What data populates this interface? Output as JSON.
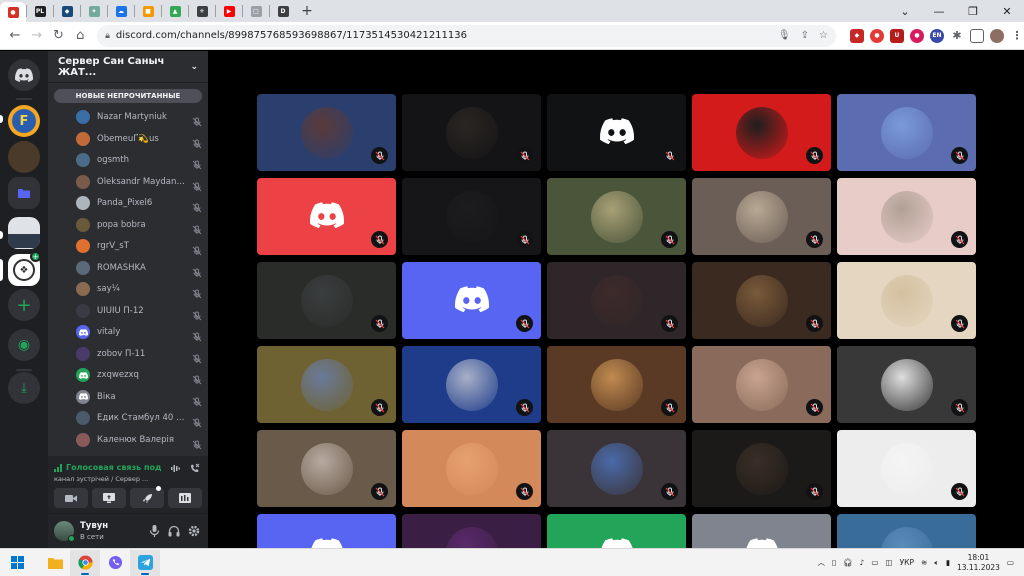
{
  "browser": {
    "tabs": [
      {
        "icon": "recording-icon",
        "color": "#d93025",
        "glyph": "●",
        "active": true
      },
      {
        "icon": "pl-icon",
        "color": "#202124",
        "glyph": "PL"
      },
      {
        "icon": "shield-icon",
        "color": "#1a4a7a",
        "glyph": "◆"
      },
      {
        "icon": "chatgpt-icon",
        "color": "#74aa9c",
        "glyph": "✦"
      },
      {
        "icon": "cloud-icon",
        "color": "#1a73e8",
        "glyph": "☁"
      },
      {
        "icon": "folder-icon",
        "color": "#f29900",
        "glyph": "■"
      },
      {
        "icon": "photo-icon",
        "color": "#34a853",
        "glyph": "▲"
      },
      {
        "icon": "emblem-icon",
        "color": "#3c4043",
        "glyph": "⚜"
      },
      {
        "icon": "youtube-icon",
        "color": "#ff0000",
        "glyph": "▶"
      },
      {
        "icon": "page-icon",
        "color": "#9aa0a6",
        "glyph": "□"
      },
      {
        "icon": "d-icon",
        "color": "#3c4043",
        "glyph": "D"
      }
    ],
    "new_tab": "+",
    "url": "discord.com/channels/899875768593698867/1173514530421211136",
    "window_controls": {
      "chevron": "⌄",
      "minimize": "—",
      "maximize": "❐",
      "close": "✕"
    }
  },
  "discord": {
    "server_name": "Сервер Сан Саныч ЖАТ...",
    "unread_label": "НОВЫЕ НЕПРОЧИТАННЫЕ",
    "members": [
      {
        "name": "Nazar Martyniuk",
        "avatar_color": "#3b6ea5"
      },
      {
        "name": "ObemeuҐ💫us",
        "avatar_color": "#c06a3a"
      },
      {
        "name": "ogsmth",
        "avatar_color": "#4a6b8a"
      },
      {
        "name": "Oleksandr Maydani...",
        "avatar_color": "#7a5a4a"
      },
      {
        "name": "Panda_Pixel6",
        "avatar_color": "#aeb4bb"
      },
      {
        "name": "popa bobra",
        "avatar_color": "#6b5a3a"
      },
      {
        "name": "rgrV_sT",
        "avatar_color": "#e07030"
      },
      {
        "name": "ROMASHKA",
        "avatar_color": "#5a6a7a"
      },
      {
        "name": "say¼",
        "avatar_color": "#8a6a50"
      },
      {
        "name": "UIUIU П-12",
        "avatar_color": "#3a3a44"
      },
      {
        "name": "vitaly",
        "avatar_color": "#5865f2",
        "discord_logo": true
      },
      {
        "name": "zobov П-11",
        "avatar_color": "#4a3a6a"
      },
      {
        "name": "zxqwezxq",
        "avatar_color": "#23a559",
        "discord_logo": true
      },
      {
        "name": "Віка",
        "avatar_color": "#80848e",
        "discord_logo": true
      },
      {
        "name": "Едик Стамбул 40 г...",
        "avatar_color": "#4a5a6a"
      },
      {
        "name": "Каленюк Валерія",
        "avatar_color": "#8a5a5a"
      }
    ],
    "voice": {
      "status": "Голосовая связь под",
      "channel": "канал зустрічей / Сервер ..."
    },
    "user": {
      "name": "Тувун",
      "status": "В сети"
    },
    "tiles": [
      {
        "bg": "#2a3f6e",
        "circle": "#5a3a3a"
      },
      {
        "bg": "#141416",
        "circle": "#2a2622"
      },
      {
        "bg": "#111214",
        "logo": true,
        "logo_color": "#ffffff"
      },
      {
        "bg": "#d41b1b",
        "circle": "#1e1e1e"
      },
      {
        "bg": "#5b6cb0",
        "circle": "#7a9ad8"
      },
      {
        "bg": "#ed4245",
        "logo": true,
        "logo_color": "#ffffff"
      },
      {
        "bg": "#161618",
        "circle": "#1c1c1e"
      },
      {
        "bg": "#4a553a",
        "circle": "#a8a076"
      },
      {
        "bg": "#6b5e56",
        "circle": "#b8a894"
      },
      {
        "bg": "#e8ccc8",
        "circle": "#b0a094"
      },
      {
        "bg": "#2a2c2a",
        "circle": "#3a3e3e"
      },
      {
        "bg": "#5865f2",
        "logo": true,
        "logo_color": "#ffffff"
      },
      {
        "bg": "#2e2628",
        "circle": "#3e2a2a"
      },
      {
        "bg": "#3a2a20",
        "circle": "#7a5a3a"
      },
      {
        "bg": "#e4d6c0",
        "circle": "#d4c0a0"
      },
      {
        "bg": "#6e6232",
        "circle": "#6a7a9a"
      },
      {
        "bg": "#1e3c8a",
        "circle": "#a8b0c8"
      },
      {
        "bg": "#5a3a24",
        "circle": "#c08a50"
      },
      {
        "bg": "#8a6a5a",
        "circle": "#c8a490"
      },
      {
        "bg": "#383838",
        "circle": "#dedede"
      },
      {
        "bg": "#6a5a4a",
        "circle": "#b8aaa0"
      },
      {
        "bg": "#d4895a",
        "circle": "#e6a070"
      },
      {
        "bg": "#3a3438",
        "circle": "#4a6aaa"
      },
      {
        "bg": "#1c1a18",
        "circle": "#3a2e26"
      },
      {
        "bg": "#ededed",
        "circle": "#f4f4f4"
      },
      {
        "bg": "#5865f2",
        "logo": true,
        "logo_color": "#ffffff"
      },
      {
        "bg": "#3a1e44",
        "circle": "#5a2a6a"
      },
      {
        "bg": "#23a559",
        "logo": true,
        "logo_color": "#ffffff"
      },
      {
        "bg": "#80848e",
        "logo": true,
        "logo_color": "#ffffff"
      },
      {
        "bg": "#3a6c9a",
        "circle": "#5a8ab8"
      }
    ]
  },
  "taskbar": {
    "language": "УКР",
    "time": "18:01",
    "date": "13.11.2023"
  }
}
